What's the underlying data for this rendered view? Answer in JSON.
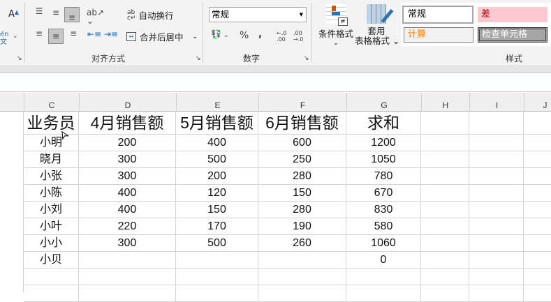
{
  "ribbon": {
    "font_partial": {
      "pinyin_label": "én\n文",
      "grow_font": "A"
    },
    "alignment": {
      "wrap_text": "自动换行",
      "merge_center": "合并后居中",
      "group_label": "对齐方式"
    },
    "number": {
      "format_value": "常规",
      "percent": "%",
      "comma": ",",
      "inc_decimal": "←.0\n.00",
      "dec_decimal": ".00\n→.0",
      "group_label": "数字"
    },
    "styles": {
      "conditional_format": "条件格式",
      "table_format_line1": "套用",
      "table_format_line2": "表格格式",
      "cell_styles": [
        {
          "label": "常规",
          "color": "#000000",
          "bg": "#ffffff"
        },
        {
          "label": "差",
          "color": "#9c0006",
          "bg": "#ffc7ce"
        },
        {
          "label": "计算",
          "color": "#fa7d00",
          "bg": "#f2f2f2"
        },
        {
          "label": "检查单元格",
          "color": "#ffffff",
          "bg": "#a5a5a5"
        }
      ],
      "group_label": "样式"
    }
  },
  "columns": [
    "C",
    "D",
    "E",
    "F",
    "G",
    "H",
    "I",
    "J"
  ],
  "table": {
    "headers": [
      "业务员",
      "4月销售额",
      "5月销售额",
      "6月销售额",
      "求和"
    ],
    "rows": [
      [
        "小明",
        "200",
        "400",
        "600",
        "1200"
      ],
      [
        "晓月",
        "300",
        "500",
        "250",
        "1050"
      ],
      [
        "小张",
        "300",
        "200",
        "280",
        "780"
      ],
      [
        "小陈",
        "400",
        "120",
        "150",
        "670"
      ],
      [
        "小刘",
        "400",
        "150",
        "280",
        "830"
      ],
      [
        "小叶",
        "220",
        "170",
        "190",
        "580"
      ],
      [
        "小小",
        "300",
        "500",
        "260",
        "1060"
      ],
      [
        "小贝",
        "",
        "",
        "",
        "0"
      ]
    ]
  }
}
